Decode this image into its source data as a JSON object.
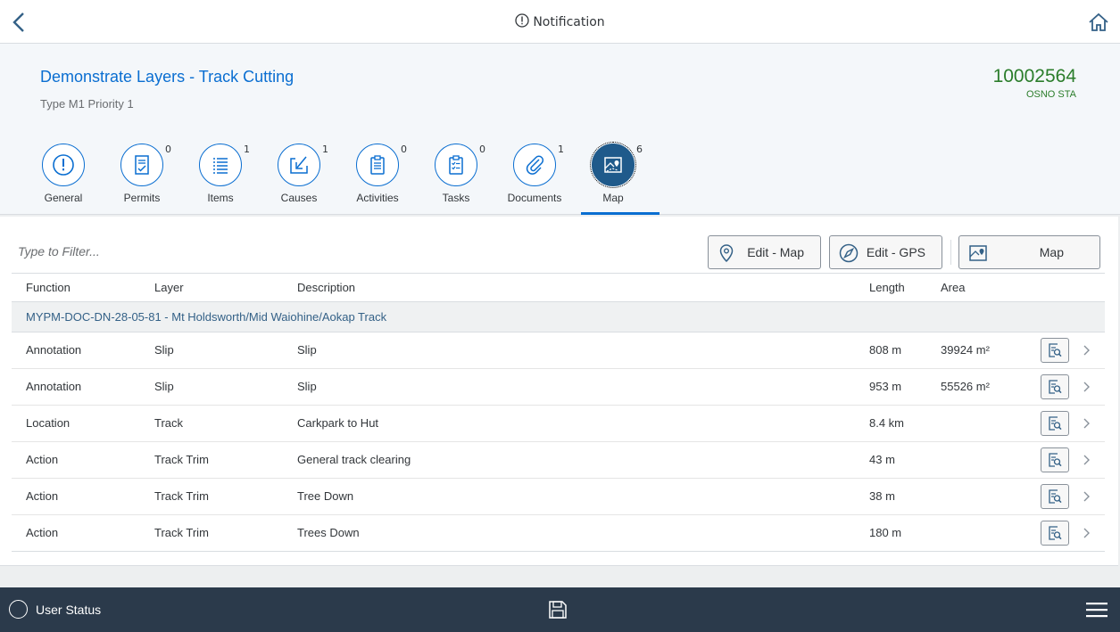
{
  "header": {
    "title": "Notification",
    "back_icon": "chevron-left-icon",
    "home_icon": "home-icon"
  },
  "object": {
    "title": "Demonstrate Layers - Track Cutting",
    "subtitle": "Type M1 Priority 1",
    "number": "10002564",
    "unit": "OSNO STA"
  },
  "tabs": [
    {
      "label": "General",
      "count": "",
      "icon": "alert-icon"
    },
    {
      "label": "Permits",
      "count": "0",
      "icon": "permit-icon"
    },
    {
      "label": "Items",
      "count": "1",
      "icon": "list-icon"
    },
    {
      "label": "Causes",
      "count": "1",
      "icon": "causes-icon"
    },
    {
      "label": "Activities",
      "count": "0",
      "icon": "clipboard-icon"
    },
    {
      "label": "Tasks",
      "count": "0",
      "icon": "task-icon"
    },
    {
      "label": "Documents",
      "count": "1",
      "icon": "paperclip-icon"
    },
    {
      "label": "Map",
      "count": "6",
      "icon": "map-icon",
      "selected": true
    }
  ],
  "toolbar": {
    "filter_placeholder": "Type to Filter...",
    "edit_map": "Edit - Map",
    "edit_gps": "Edit - GPS",
    "map": "Map"
  },
  "table": {
    "columns": {
      "function": "Function",
      "layer": "Layer",
      "description": "Description",
      "length": "Length",
      "area": "Area"
    },
    "group": "MYPM-DOC-DN-28-05-81 - Mt Holdsworth/Mid Waiohine/Aokap Track",
    "rows": [
      {
        "function": "Annotation",
        "layer": "Slip",
        "description": "Slip",
        "length": "808 m",
        "area": "39924 m²"
      },
      {
        "function": "Annotation",
        "layer": "Slip",
        "description": "Slip",
        "length": "953 m",
        "area": "55526 m²"
      },
      {
        "function": "Location",
        "layer": "Track",
        "description": "Carkpark to Hut",
        "length": "8.4 km",
        "area": ""
      },
      {
        "function": "Action",
        "layer": "Track Trim",
        "description": "General track clearing",
        "length": "43 m",
        "area": ""
      },
      {
        "function": "Action",
        "layer": "Track Trim",
        "description": "Tree Down",
        "length": "38 m",
        "area": ""
      },
      {
        "function": "Action",
        "layer": "Track Trim",
        "description": "Trees Down",
        "length": "180 m",
        "area": ""
      }
    ]
  },
  "footer": {
    "user_status": "User Status"
  },
  "colors": {
    "brand": "#0a6ed1",
    "number": "#2b7d2b",
    "footer": "#2b3a4b",
    "selected_tab": "#1f5a8b"
  }
}
